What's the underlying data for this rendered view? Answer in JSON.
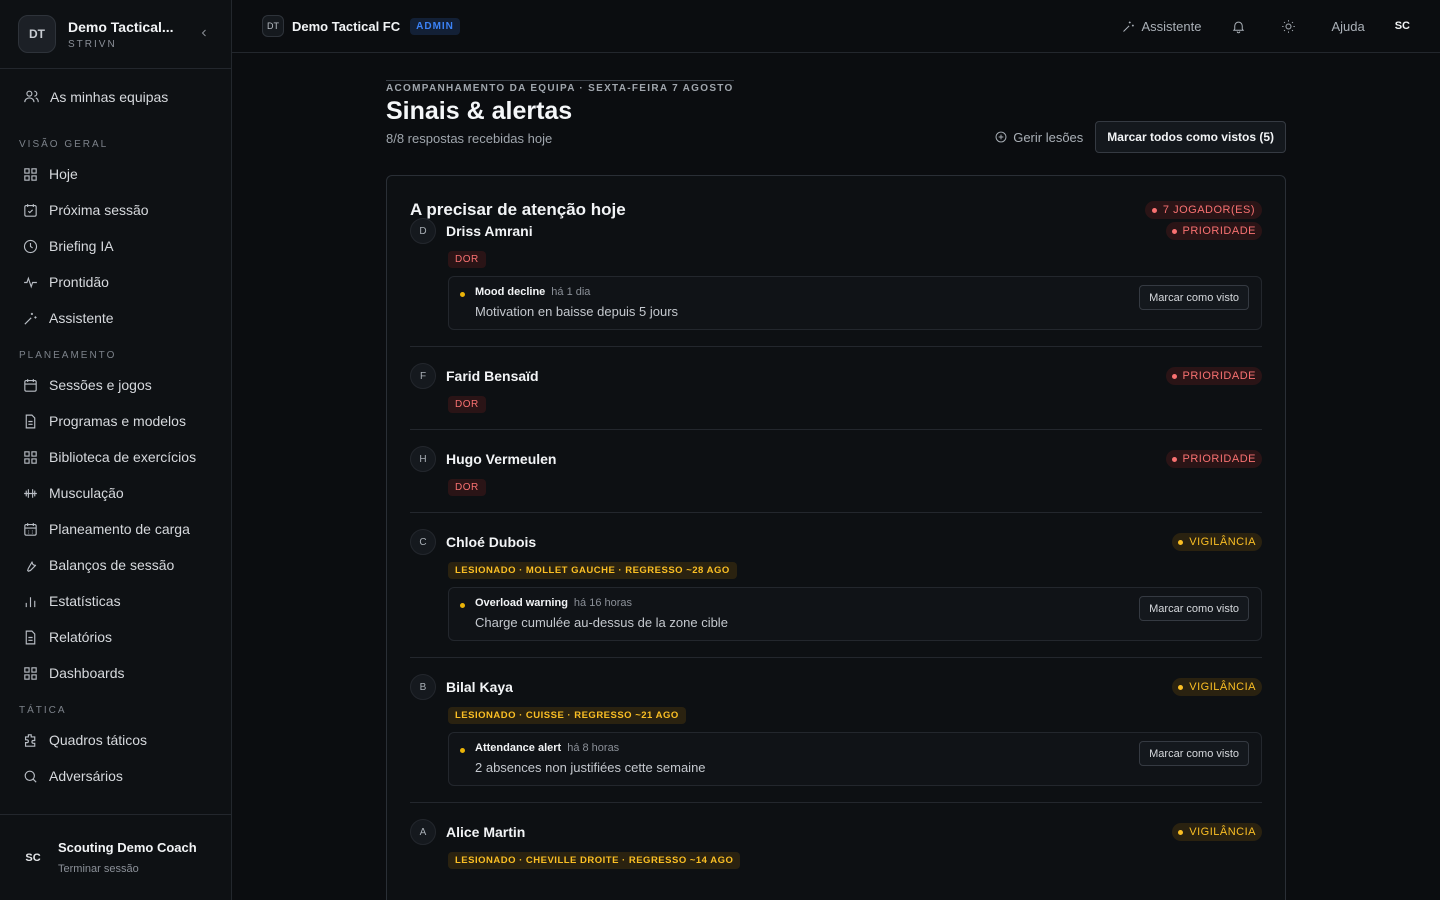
{
  "sidebar": {
    "team_initials": "DT",
    "team_name": "Demo Tactical...",
    "team_org": "STRIVN",
    "my_teams": "As minhas equipas",
    "sections": {
      "overview": "VISÃO GERAL",
      "planning": "PLANEAMENTO",
      "tactics": "TÁTICA"
    },
    "overview_items": [
      "Hoje",
      "Próxima sessão",
      "Briefing IA",
      "Prontidão",
      "Assistente"
    ],
    "planning_items": [
      "Sessões e jogos",
      "Programas e modelos",
      "Biblioteca de exercícios",
      "Musculação",
      "Planeamento de carga",
      "Balanços de sessão",
      "Estatísticas",
      "Relatórios",
      "Dashboards"
    ],
    "tactics_items": [
      "Quadros táticos",
      "Adversários"
    ],
    "user_initials": "SC",
    "user_name": "Scouting Demo Coach",
    "logout": "Terminar sessão"
  },
  "topbar": {
    "team_initials": "DT",
    "team_name": "Demo Tactical FC",
    "role_badge": "ADMIN",
    "assistant": "Assistente",
    "help": "Ajuda",
    "user_initials": "SC"
  },
  "header": {
    "eyebrow": "ACOMPANHAMENTO DA EQUIPA · SEXTA-FEIRA 7 AGOSTO",
    "title": "Sinais & alertas",
    "subtitle": "8/8 respostas recebidas hoje",
    "manage_injuries": "Gerir lesões",
    "mark_all": "Marcar todos como vistos (5)"
  },
  "card": {
    "title": "A precisar de atenção hoje",
    "count_badge": "7 JOGADOR(ES)",
    "seen_label": "Marcar como visto",
    "players": [
      {
        "initial": "D",
        "name": "Driss Amrani",
        "status": "PRIORIDADE",
        "tag": "DOR",
        "alert": {
          "type": "Mood decline",
          "time": "há 1 dia",
          "message": "Motivation en baisse depuis 5 jours"
        }
      },
      {
        "initial": "F",
        "name": "Farid Bensaïd",
        "status": "PRIORIDADE",
        "tag": "DOR"
      },
      {
        "initial": "H",
        "name": "Hugo Vermeulen",
        "status": "PRIORIDADE",
        "tag": "DOR"
      },
      {
        "initial": "C",
        "name": "Chloé Dubois",
        "status": "VIGILÂNCIA",
        "tag": "LESIONADO · MOLLET GAUCHE · REGRESSO ~28 AGO",
        "alert": {
          "type": "Overload warning",
          "time": "há 16 horas",
          "message": "Charge cumulée au-dessus de la zone cible"
        }
      },
      {
        "initial": "B",
        "name": "Bilal Kaya",
        "status": "VIGILÂNCIA",
        "tag": "LESIONADO · CUISSE · REGRESSO ~21 AGO",
        "alert": {
          "type": "Attendance alert",
          "time": "há 8 horas",
          "message": "2 absences non justifiées cette semaine"
        }
      },
      {
        "initial": "A",
        "name": "Alice Martin",
        "status": "VIGILÂNCIA",
        "tag": "LESIONADO · CHEVILLE DROITE · REGRESSO ~14 AGO"
      }
    ]
  },
  "colors": {
    "priority": "#f87171",
    "watch": "#fbbf24",
    "admin": "#3b82f6"
  }
}
